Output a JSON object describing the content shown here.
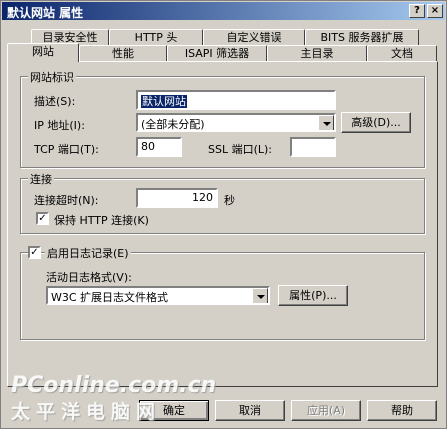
{
  "window": {
    "title": "默认网站 属性"
  },
  "titlebar_buttons": {
    "help": "?",
    "close": "×"
  },
  "tabs_back": [
    "目录安全性",
    "HTTP 头",
    "自定义错误",
    "BITS 服务器扩展"
  ],
  "tabs_front": [
    "网站",
    "性能",
    "ISAPI 筛选器",
    "主目录",
    "文档"
  ],
  "identity": {
    "group_label": "网站标识",
    "desc_label": "描述(S):",
    "desc_value": "默认网站",
    "ip_label": "IP 地址(I):",
    "ip_value": "(全部未分配)",
    "advanced_button": "高级(D)...",
    "tcp_label": "TCP 端口(T):",
    "tcp_value": "80",
    "ssl_label": "SSL 端口(L):",
    "ssl_value": ""
  },
  "connection": {
    "group_label": "连接",
    "timeout_label": "连接超时(N):",
    "timeout_value": "120",
    "timeout_unit": "秒",
    "keepalive_label": "保持 HTTP 连接(K)",
    "keepalive_checked": true
  },
  "logging": {
    "enable_label": "启用日志记录(E)",
    "enable_checked": true,
    "format_label": "活动日志格式(V):",
    "format_value": "W3C 扩展日志文件格式",
    "properties_button": "属性(P)..."
  },
  "footer": {
    "ok": "确定",
    "cancel": "取消",
    "apply": "应用(A)",
    "help": "帮助"
  },
  "watermark": {
    "line1": "PConline.com.cn",
    "line2": "太平洋电脑网"
  }
}
